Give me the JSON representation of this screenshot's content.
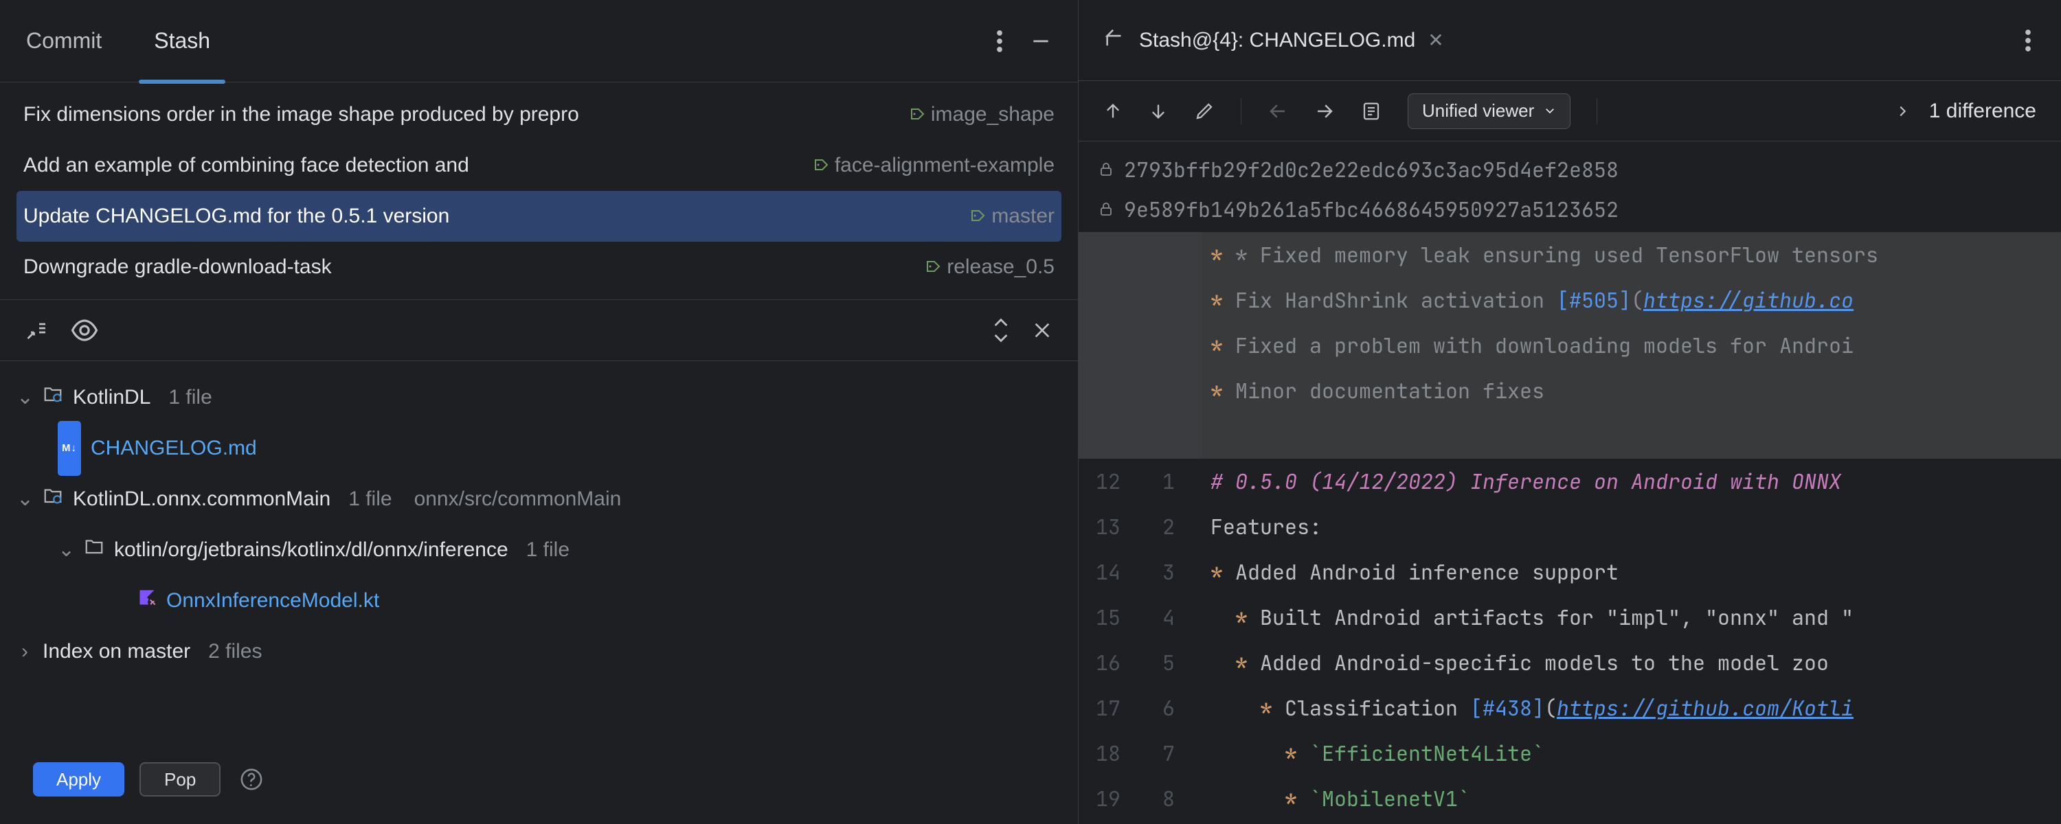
{
  "tabs": {
    "commit": "Commit",
    "stash": "Stash"
  },
  "commits": [
    {
      "msg": "Fix dimensions order in the image shape produced by prepro",
      "tag": "image_shape"
    },
    {
      "msg": "Add an example of combining face detection and ",
      "tag": "face-alignment-example"
    },
    {
      "msg": "Update CHANGELOG.md for the 0.5.1 version",
      "tag": "master"
    },
    {
      "msg": "Downgrade gradle-download-task",
      "tag": "release_0.5"
    }
  ],
  "tree": {
    "kotlindl": {
      "name": "KotlinDL",
      "meta": "1 file"
    },
    "changelog": "CHANGELOG.md",
    "onnx": {
      "name": "KotlinDL.onnx.commonMain",
      "meta": "1 file",
      "path": "onnx/src/commonMain"
    },
    "inference_pkg": {
      "name": "kotlin/org/jetbrains/kotlinx/dl/onnx/inference",
      "meta": "1 file"
    },
    "onnx_file": "OnnxInferenceModel.kt",
    "index": {
      "name": "Index on master",
      "meta": "2 files"
    }
  },
  "buttons": {
    "apply": "Apply",
    "pop": "Pop"
  },
  "editor": {
    "title": "Stash@{4}: CHANGELOG.md"
  },
  "diff": {
    "viewer_mode": "Unified viewer",
    "count": "1 difference",
    "hash1": "2793bffb29f2d0c2e22edc693c3ac95d4ef2e858",
    "hash2": "9e589fb149b261a5fbc4668645950927a5123652"
  },
  "code": {
    "d1": "* Fixed memory leak ensuring used TensorFlow tensors",
    "d2a": "* Fix HardShrink activation ",
    "d2b": "[#505]",
    "d2c": "(",
    "d2d": "https://github.co",
    "d3": "* Fixed a problem with downloading models for Androi",
    "d4": "* Minor documentation fixes",
    "l12": "# 0.5.0 (14/12/2022) Inference on Android with ONNX",
    "l13": "Features:",
    "l14": "* Added Android inference support",
    "l15a": "  * Built Android artifacts for \"impl\", \"onnx\" and \"",
    "l16": "  * Added Android-specific models to the model zoo",
    "l17a": "    * Classification ",
    "l17b": "[#438]",
    "l17c": "(",
    "l17d": "https://github.com/Kotli",
    "l18a": "      * ",
    "l18b": "`EfficientNet4Lite`",
    "l19a": "      * ",
    "l19b": "`MobilenetV1`",
    "ln": {
      "n12": "12",
      "n13": "13",
      "n14": "14",
      "n15": "15",
      "n16": "16",
      "n17": "17",
      "n18": "18",
      "n19": "19",
      "m1": "1",
      "m2": "2",
      "m3": "3",
      "m4": "4",
      "m5": "5",
      "m6": "6",
      "m7": "7",
      "m8": "8"
    }
  }
}
